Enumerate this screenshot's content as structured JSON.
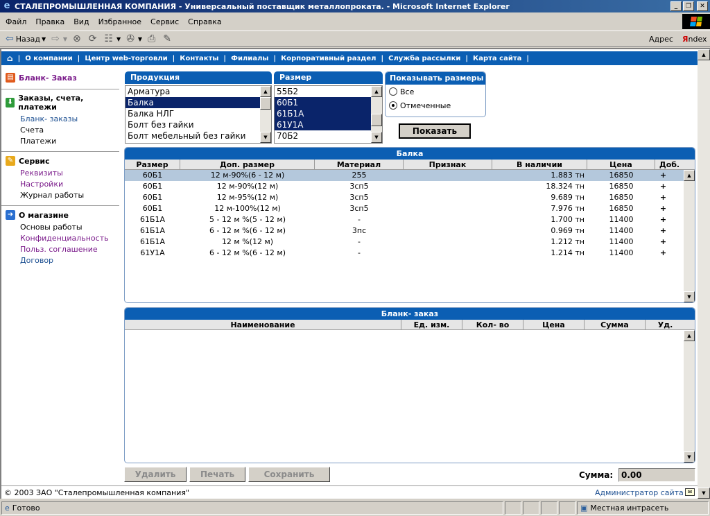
{
  "window": {
    "title": "СТАЛЕПРОМЫШЛЕННАЯ КОМПАНИЯ - Универсальный поставщик металлопроката. - Microsoft Internet Explorer",
    "minimize": "_",
    "maximize": "❐",
    "close": "✕"
  },
  "menu": [
    "Файл",
    "Правка",
    "Вид",
    "Избранное",
    "Сервис",
    "Справка"
  ],
  "toolbar": {
    "back_label": "Назад",
    "address_label": "Адрес",
    "yandex_y": "Я",
    "yandex_rest": "ndex"
  },
  "nav": {
    "items": [
      "О компании",
      "Центр web-торговли",
      "Контакты",
      "Филиалы",
      "Корпоративный раздел",
      "Служба рассылки",
      "Карта сайта"
    ]
  },
  "sidebar": {
    "order_form": "Бланк- Заказ",
    "orders": {
      "title": "Заказы, счета, платежи",
      "links": [
        "Бланк- заказы",
        "Счета",
        "Платежи"
      ]
    },
    "service": {
      "title": "Сервис",
      "links": [
        "Реквизиты",
        "Настройки",
        "Журнал работы"
      ]
    },
    "shop": {
      "title": "О магазине",
      "links": [
        "Основы работы",
        "Конфиденциальность",
        "Польз. соглашение",
        "Договор"
      ]
    }
  },
  "products": {
    "header": "Продукция",
    "options": [
      "Арматура",
      "Балка",
      "Балка НЛГ",
      "Болт без гайки",
      "Болт мебельный без гайки"
    ],
    "selected_index": 1
  },
  "sizes": {
    "header": "Размер",
    "options": [
      "55Б2",
      "60Б1",
      "61Б1А",
      "61У1А",
      "70Б2"
    ],
    "selected_indices": [
      1,
      2,
      3
    ]
  },
  "show_sizes": {
    "header": "Показывать размеры",
    "all": "Все",
    "marked": "Отмеченные",
    "selected": "marked"
  },
  "show_button": "Показать",
  "stock_table": {
    "title": "Балка",
    "columns": [
      "Размер",
      "Доп. размер",
      "Материал",
      "Признак",
      "В наличии",
      "Цена",
      "Доб."
    ],
    "rows": [
      [
        "60Б1",
        "12 м-90%(6 - 12 м)",
        "255",
        "",
        "1.883 тн",
        "16850",
        "+"
      ],
      [
        "60Б1",
        "12 м-90%(12 м)",
        "3сп5",
        "",
        "18.324 тн",
        "16850",
        "+"
      ],
      [
        "60Б1",
        "12 м-95%(12 м)",
        "3сп5",
        "",
        "9.689 тн",
        "16850",
        "+"
      ],
      [
        "60Б1",
        "12 м-100%(12 м)",
        "3сп5",
        "",
        "7.976 тн",
        "16850",
        "+"
      ],
      [
        "61Б1А",
        "5 - 12 м %(5 - 12 м)",
        "-",
        "",
        "1.700 тн",
        "11400",
        "+"
      ],
      [
        "61Б1А",
        "6 - 12 м %(6 - 12 м)",
        "3пс",
        "",
        "0.969 тн",
        "11400",
        "+"
      ],
      [
        "61Б1А",
        "12 м %(12 м)",
        "-",
        "",
        "1.212 тн",
        "11400",
        "+"
      ],
      [
        "61У1А",
        "6 - 12 м %(6 - 12 м)",
        "-",
        "",
        "1.214 тн",
        "11400",
        "+"
      ]
    ],
    "highlighted_row": 0
  },
  "order_table": {
    "title": "Бланк- заказ",
    "columns": [
      "Наименование",
      "Ед. изм.",
      "Кол- во",
      "Цена",
      "Сумма",
      "Уд."
    ]
  },
  "buttons": {
    "delete": "Удалить",
    "print": "Печать",
    "save": "Сохранить"
  },
  "sum": {
    "label": "Сумма:",
    "value": "0.00"
  },
  "footer": {
    "copyright": "© 2003 ЗАО \"Сталепромышленная компания\"",
    "admin": "Администратор сайта"
  },
  "status": {
    "ready": "Готово",
    "zone": "Местная интрасеть"
  },
  "colors": {
    "accent": "#0b5eb3",
    "selected": "#0a246a",
    "row_highlight": "#b4c8dc"
  }
}
